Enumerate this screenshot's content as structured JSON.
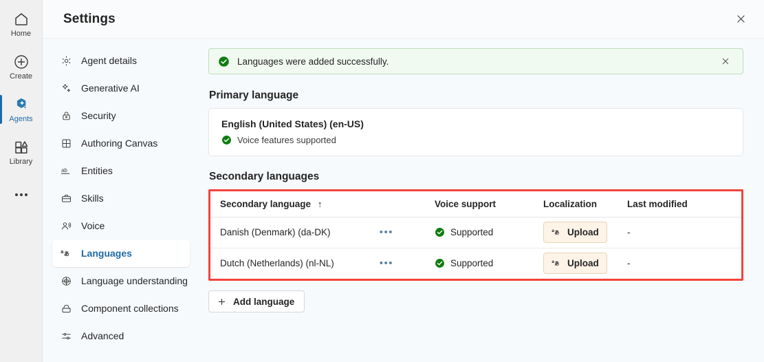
{
  "rail": {
    "items": [
      {
        "label": "Home",
        "icon": "home-icon",
        "active": false
      },
      {
        "label": "Create",
        "icon": "plus-circle-icon",
        "active": false
      },
      {
        "label": "Agents",
        "icon": "agents-icon",
        "active": true
      },
      {
        "label": "Library",
        "icon": "library-icon",
        "active": false
      }
    ],
    "overflow_icon": "more-horizontal-icon"
  },
  "header": {
    "title": "Settings",
    "close_icon": "close-icon"
  },
  "settings_nav": {
    "items": [
      {
        "label": "Agent details",
        "icon": "gear-icon",
        "selected": false
      },
      {
        "label": "Generative AI",
        "icon": "sparkle-icon",
        "selected": false
      },
      {
        "label": "Security",
        "icon": "lock-icon",
        "selected": false
      },
      {
        "label": "Authoring Canvas",
        "icon": "grid-icon",
        "selected": false
      },
      {
        "label": "Entities",
        "icon": "ab-icon",
        "selected": false
      },
      {
        "label": "Skills",
        "icon": "briefcase-icon",
        "selected": false
      },
      {
        "label": "Voice",
        "icon": "voice-icon",
        "selected": false
      },
      {
        "label": "Languages",
        "icon": "languages-icon",
        "selected": true
      },
      {
        "label": "Language understanding",
        "icon": "globe-brain-icon",
        "selected": false
      },
      {
        "label": "Component collections",
        "icon": "collections-icon",
        "selected": false
      },
      {
        "label": "Advanced",
        "icon": "sliders-icon",
        "selected": false
      }
    ]
  },
  "banner": {
    "message": "Languages were added successfully.",
    "status_icon": "success-check-icon",
    "close_icon": "close-icon",
    "accent_color": "#107c10",
    "background_color": "#f1faf1"
  },
  "primary_language": {
    "heading": "Primary language",
    "name": "English (United States) (en-US)",
    "voice_status": "Voice features supported",
    "voice_status_icon": "success-check-icon"
  },
  "secondary_languages": {
    "heading": "Secondary languages",
    "highlight_color": "#f4423c",
    "columns": [
      {
        "label": "Secondary language",
        "sort_icon": "arrow-up-icon",
        "sorted": true
      },
      {
        "label": "Voice support",
        "sort_icon": "",
        "sorted": false
      },
      {
        "label": "Localization",
        "sort_icon": "",
        "sorted": false
      },
      {
        "label": "Last modified",
        "sort_icon": "",
        "sorted": false
      }
    ],
    "rows": [
      {
        "language": "Danish (Denmark) (da-DK)",
        "overflow_label": "•••",
        "voice_support": "Supported",
        "voice_support_icon": "success-check-icon",
        "localization_label": "Upload",
        "localization_icon": "languages-icon",
        "last_modified": "-"
      },
      {
        "language": "Dutch (Netherlands) (nl-NL)",
        "overflow_label": "•••",
        "voice_support": "Supported",
        "voice_support_icon": "success-check-icon",
        "localization_label": "Upload",
        "localization_icon": "languages-icon",
        "last_modified": "-"
      }
    ],
    "add_button": {
      "label": "Add language",
      "icon": "plus-icon"
    }
  }
}
